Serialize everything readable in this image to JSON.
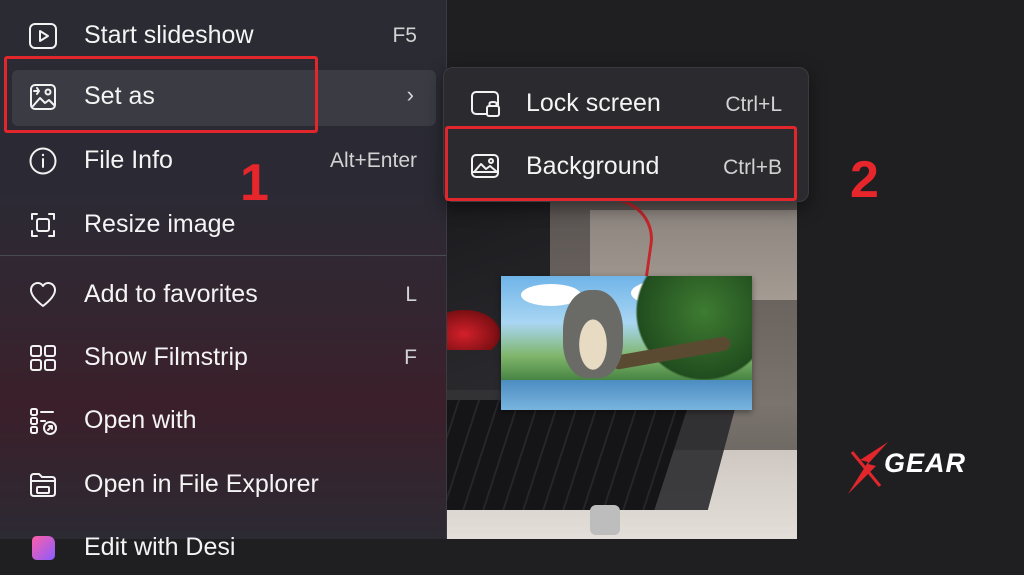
{
  "menu": {
    "items": [
      {
        "id": "start-slideshow",
        "label": "Start slideshow",
        "shortcut": "F5",
        "icon": "play-icon"
      },
      {
        "id": "set-as",
        "label": "Set as",
        "shortcut": "",
        "icon": "set-as-image-icon",
        "has_submenu": true
      },
      {
        "id": "file-info",
        "label": "File Info",
        "shortcut": "Alt+Enter",
        "icon": "info-icon"
      },
      {
        "id": "resize-image",
        "label": "Resize image",
        "shortcut": "",
        "icon": "resize-icon"
      },
      {
        "id": "add-to-favorites",
        "label": "Add to favorites",
        "shortcut": "L",
        "icon": "heart-icon"
      },
      {
        "id": "show-filmstrip",
        "label": "Show Filmstrip",
        "shortcut": "F",
        "icon": "grid-icon"
      },
      {
        "id": "open-with",
        "label": "Open with",
        "shortcut": "",
        "icon": "open-with-icon"
      },
      {
        "id": "open-in-file-explorer",
        "label": "Open in File Explorer",
        "shortcut": "",
        "icon": "folder-icon"
      },
      {
        "id": "edit-with-designer",
        "label": "Edit with Desi",
        "shortcut": "",
        "icon": "designer-icon"
      }
    ]
  },
  "submenu": {
    "items": [
      {
        "id": "lock-screen",
        "label": "Lock screen",
        "shortcut": "Ctrl+L",
        "icon": "lock-screen-icon"
      },
      {
        "id": "background",
        "label": "Background",
        "shortcut": "Ctrl+B",
        "icon": "background-icon"
      }
    ]
  },
  "annotations": {
    "step1": "1",
    "step2": "2"
  },
  "logo": {
    "text": "GEAR",
    "mark": "X"
  },
  "colors": {
    "accent_red": "#e1262c",
    "menu_bg": "#2b2b30",
    "text": "#f4f4f4"
  }
}
